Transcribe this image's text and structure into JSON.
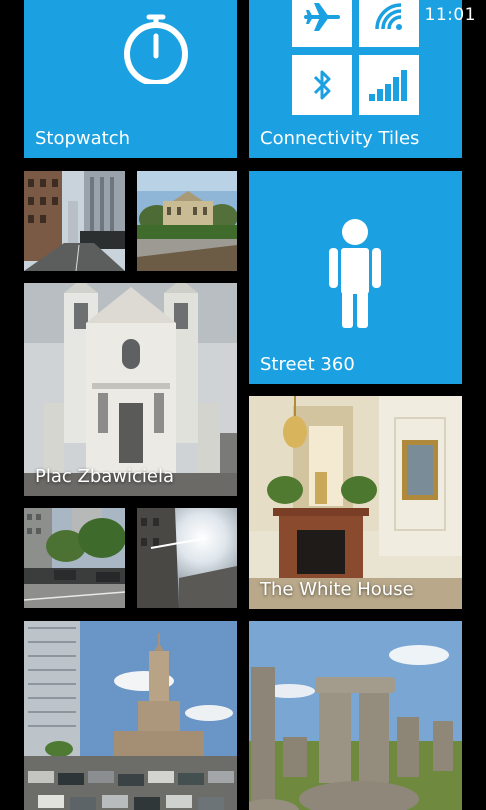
{
  "status_bar": {
    "time": "11:01"
  },
  "colors": {
    "accent": "#1ba1e2",
    "background": "#000000"
  },
  "tiles": {
    "stopwatch": {
      "label": "Stopwatch",
      "icon": "stopwatch-icon"
    },
    "connectivity": {
      "label": "Connectivity Tiles",
      "icons": [
        "airplane-icon",
        "wifi-icon",
        "bluetooth-icon",
        "signal-bars-icon"
      ]
    },
    "street360": {
      "label": "Street 360",
      "icon": "person-icon"
    },
    "plac": {
      "label": "Plac Zbawiciela"
    },
    "white_house": {
      "label": "The White House"
    }
  }
}
